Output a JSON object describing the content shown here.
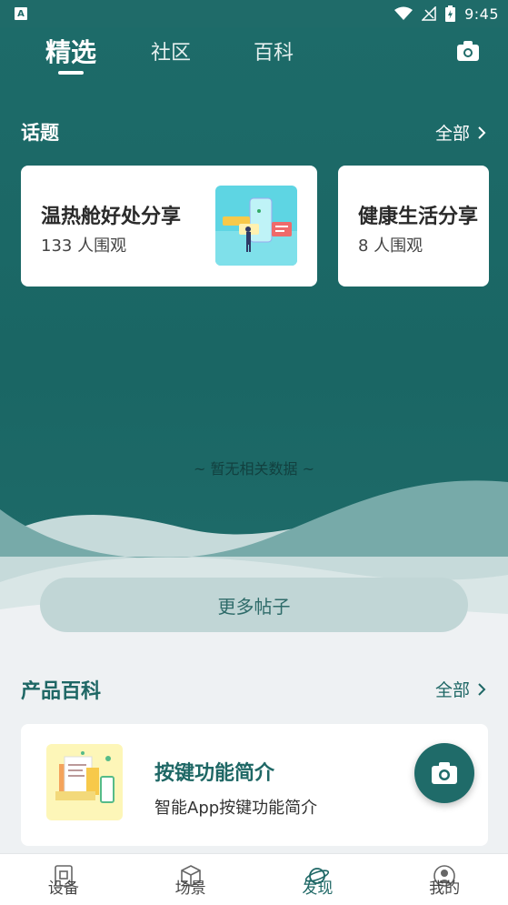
{
  "status_bar": {
    "time": "9:45",
    "notification_icon": "A"
  },
  "header": {
    "tabs": [
      {
        "label": "精选",
        "active": true
      },
      {
        "label": "社区",
        "active": false
      },
      {
        "label": "百科",
        "active": false
      }
    ],
    "camera_icon": "camera-icon"
  },
  "topics": {
    "title": "话题",
    "all_label": "全部",
    "cards": [
      {
        "title": "温热舱好处分享",
        "views": "133 人围观"
      },
      {
        "title": "健康生活分享",
        "views": "8 人围观"
      }
    ]
  },
  "empty_state": {
    "text": "~ 暂无相关数据 ~"
  },
  "more_posts_label": "更多帖子",
  "product_wiki": {
    "title": "产品百科",
    "all_label": "全部",
    "items": [
      {
        "title": "按键功能简介",
        "subtitle": "智能App按键功能简介"
      }
    ]
  },
  "bottom_nav": {
    "items": [
      {
        "label": "设备",
        "icon": "device-icon",
        "active": false
      },
      {
        "label": "场景",
        "icon": "cube-icon",
        "active": false
      },
      {
        "label": "发现",
        "icon": "planet-icon",
        "active": true
      },
      {
        "label": "我的",
        "icon": "profile-icon",
        "active": false
      }
    ]
  },
  "colors": {
    "primary": "#1e6a68",
    "light_accent": "#c1d6d6",
    "background": "#eef1f3"
  }
}
